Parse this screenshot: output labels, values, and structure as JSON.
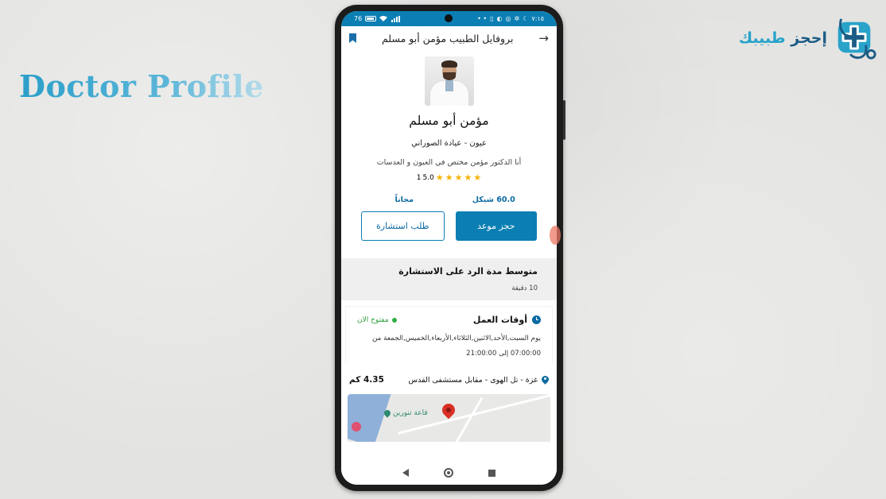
{
  "promo": {
    "title": "Doctor Profile"
  },
  "brand": {
    "name_part1": "إحجز",
    "name_part2": "طبيبك",
    "logo": "stethoscope-cross-logo",
    "colors": {
      "dark": "#1b5c86",
      "light": "#27a3c9"
    }
  },
  "statusbar": {
    "battery": "76",
    "time": "٧:١٥"
  },
  "appbar": {
    "title": "بروفايل الطبيب مؤمن  أبو مسلم",
    "back_icon": "arrow-right-icon",
    "bookmark_icon": "bookmark-icon"
  },
  "profile": {
    "name": "مؤمن  أبو مسلم",
    "specialty": "عيون - عيادة الصوراني",
    "bio": "أنا الدكتور مؤمن مختص في العيون و العدسات",
    "rating_value": "5.0",
    "rating_count": "1",
    "stars": 5
  },
  "prices": {
    "appointment": "60.0 شيكل",
    "consultation": "مجاناً"
  },
  "actions": {
    "book": "حجز موعد",
    "consult": "طلب استشارة"
  },
  "response": {
    "title": "متوسط مدة الرد على الاستشارة",
    "value": "10 دقيقة"
  },
  "hours": {
    "title": "أوقات العمل",
    "status": "مفتوح الان",
    "days": "يوم السبت,الأحد,الاثنين,الثلاثاء,الأربعاء,الخميس,الجمعة من",
    "range_from": "07:00:00",
    "range_sep": "إلى",
    "range_to": "21:00:00"
  },
  "location": {
    "address": "غزة - تل الهوى - مقابل مستشفى القدس",
    "distance": "4.35 كم"
  },
  "map": {
    "place_label": "قاعة تنورين"
  },
  "colors": {
    "primary": "#0b7fb3",
    "open_green": "#2e9e3e",
    "star": "#f5b301"
  }
}
